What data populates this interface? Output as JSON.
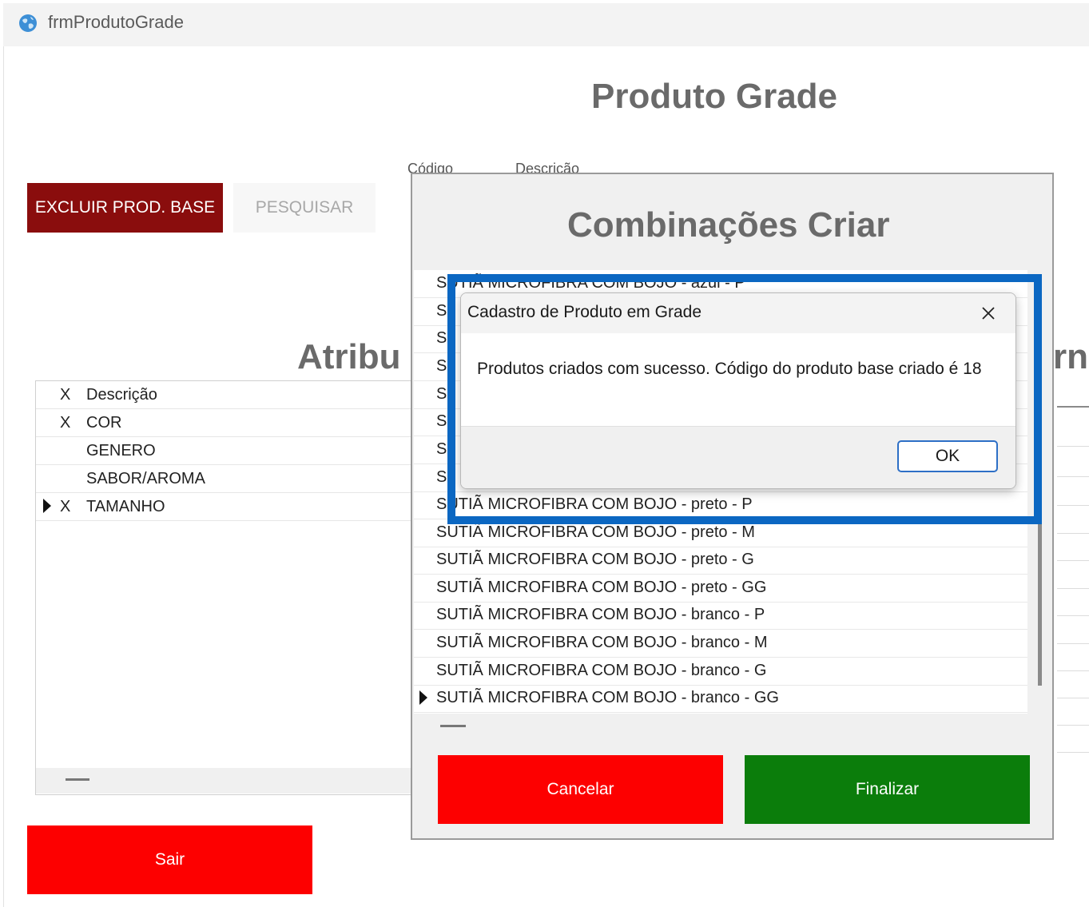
{
  "window": {
    "title": "frmProdutoGrade",
    "icon": "globe-icon"
  },
  "header": {
    "title": "Produto Grade"
  },
  "toolbar": {
    "excluir_label": "EXCLUIR PROD. BASE",
    "pesquisar_label": "PESQUISAR"
  },
  "search_columns": {
    "codigo": "Código",
    "descricao": "Descrição"
  },
  "attributes": {
    "title": "Atribu",
    "header": {
      "x": "X",
      "descricao": "Descrição"
    },
    "rows": [
      {
        "x": "X",
        "descricao": "COR",
        "current": false
      },
      {
        "x": "",
        "descricao": "GENERO",
        "current": false
      },
      {
        "x": "",
        "descricao": "SABOR/AROMA",
        "current": false
      },
      {
        "x": "X",
        "descricao": "TAMANHO",
        "current": true
      }
    ]
  },
  "right_fragment": "rn",
  "sair_label": "Sair",
  "combinacoes": {
    "title": "Combinações Criar",
    "rows": [
      "SUTIÃ MICROFIBRA COM BOJO - azul - P",
      "S",
      "S",
      "S",
      "S",
      "S",
      "S",
      "S",
      "SUTIÃ MICROFIBRA COM BOJO - preto - P",
      "SUTIÃ MICROFIBRA COM BOJO - preto - M",
      "SUTIÃ MICROFIBRA COM BOJO - preto - G",
      "SUTIÃ MICROFIBRA COM BOJO - preto - GG",
      "SUTIÃ MICROFIBRA COM BOJO - branco - P",
      "SUTIÃ MICROFIBRA COM BOJO - branco - M",
      "SUTIÃ MICROFIBRA COM BOJO - branco - G",
      "SUTIÃ MICROFIBRA COM BOJO - branco - GG"
    ],
    "cancelar_label": "Cancelar",
    "finalizar_label": "Finalizar"
  },
  "message_box": {
    "title": "Cadastro de Produto em Grade",
    "text": "Produtos criados com sucesso. Código do produto base criado é 18",
    "ok_label": "OK"
  },
  "colors": {
    "excluir": "#8a0d0d",
    "sair": "#fd0000",
    "cancelar": "#fd0000",
    "finalizar": "#0b7d0b",
    "highlight": "#0b67c2"
  }
}
